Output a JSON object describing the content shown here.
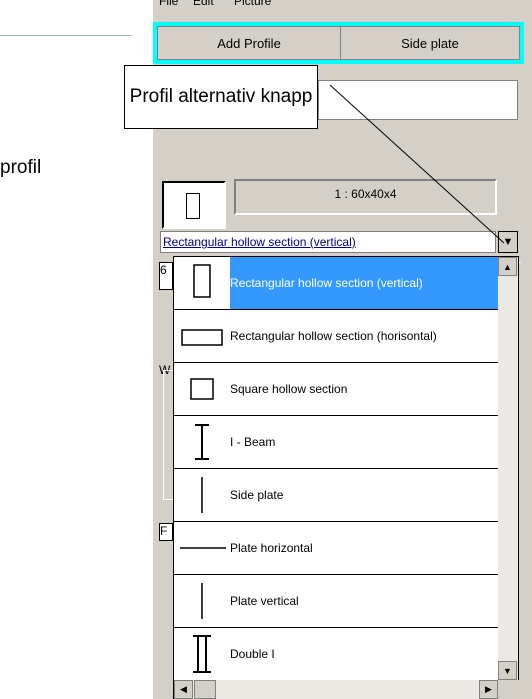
{
  "menu": {
    "items": [
      "File",
      "Edit",
      "Picture"
    ]
  },
  "toolbar": {
    "add_profile": "Add Profile",
    "side_plate": "Side plate"
  },
  "callout": {
    "text": "Profil alternativ knapp"
  },
  "side_text": "profil",
  "readout": {
    "value": "1 : 60x40x4"
  },
  "combo": {
    "selected": "Rectangular hollow section  (vertical)"
  },
  "hidden_field": {
    "value": "6"
  },
  "labels": {
    "w": "W",
    "f": "F"
  },
  "profiles": [
    {
      "label": "Rectangular hollow section  (vertical)",
      "icon": "rect-vertical-icon",
      "selected": true
    },
    {
      "label": "Rectangular hollow section  (horisontal)",
      "icon": "rect-horizontal-icon",
      "selected": false
    },
    {
      "label": "Square hollow section",
      "icon": "square-icon",
      "selected": false
    },
    {
      "label": "I - Beam",
      "icon": "i-beam-icon",
      "selected": false
    },
    {
      "label": "Side plate",
      "icon": "side-plate-icon",
      "selected": false
    },
    {
      "label": "Plate horizontal",
      "icon": "plate-horizontal-icon",
      "selected": false
    },
    {
      "label": "Plate vertical",
      "icon": "plate-vertical-icon",
      "selected": false
    },
    {
      "label": "Double I",
      "icon": "double-i-icon",
      "selected": false
    }
  ],
  "colors": {
    "toolbar": "#00ffff",
    "selection": "#3399ff",
    "window": "#d4d0c8"
  }
}
